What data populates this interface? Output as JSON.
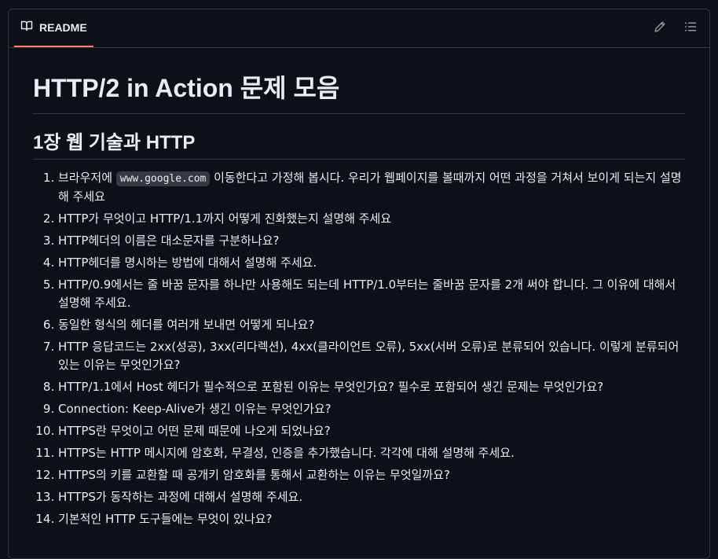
{
  "header": {
    "tab_label": "README",
    "icons": {
      "tab": "book-icon",
      "edit": "pencil-icon",
      "toc": "list-icon"
    },
    "accent_color": "#f78166"
  },
  "readme": {
    "title": "HTTP/2 in Action 문제 모음",
    "section1": {
      "heading": "1장 웹 기술과 HTTP",
      "items": [
        {
          "pre": "브라우저에 ",
          "code": "www.google.com",
          "post": " 이동한다고 가정해 봅시다. 우리가 웹페이지를 볼때까지 어떤 과정을 거쳐서 보이게 되는지 설명해 주세요"
        },
        {
          "text": "HTTP가 무엇이고 HTTP/1.1까지 어떻게 진화했는지 설명해 주세요"
        },
        {
          "text": "HTTP헤더의 이름은 대소문자를 구분하나요?"
        },
        {
          "text": "HTTP헤더를 명시하는 방법에 대해서 설명해 주세요."
        },
        {
          "text": "HTTP/0.9에서는 줄 바꿈 문자를 하나만 사용해도 되는데 HTTP/1.0부터는 줄바꿈 문자를 2개 써야 합니다. 그 이유에 대해서 설명해 주세요."
        },
        {
          "text": "동일한 형식의 헤더를 여러개 보내면 어떻게 되나요?"
        },
        {
          "text": "HTTP 응답코드는 2xx(성공), 3xx(리다렉션), 4xx(클라이언트 오류), 5xx(서버 오류)로 분류되어 있습니다. 이렇게 분류되어 있는 이유는 무엇인가요?"
        },
        {
          "text": "HTTP/1.1에서 Host 헤더가 필수적으로 포함된 이유는 무엇인가요? 필수로 포함되어 생긴 문제는 무엇인가요?"
        },
        {
          "text": "Connection: Keep-Alive가 생긴 이유는 무엇인가요?"
        },
        {
          "text": "HTTPS란 무엇이고 어떤 문제 때문에 나오게 되었나요?"
        },
        {
          "text": "HTTPS는 HTTP 메시지에 암호화, 무결성, 인증을 추가했습니다. 각각에 대해 설명해 주세요."
        },
        {
          "text": "HTTPS의 키를 교환할 때 공개키 암호화를 통해서 교환하는 이유는 무엇일까요?"
        },
        {
          "text": "HTTPS가 동작하는 과정에 대해서 설명해 주세요."
        },
        {
          "text": "기본적인 HTTP 도구들에는 무엇이 있나요?"
        }
      ]
    }
  }
}
